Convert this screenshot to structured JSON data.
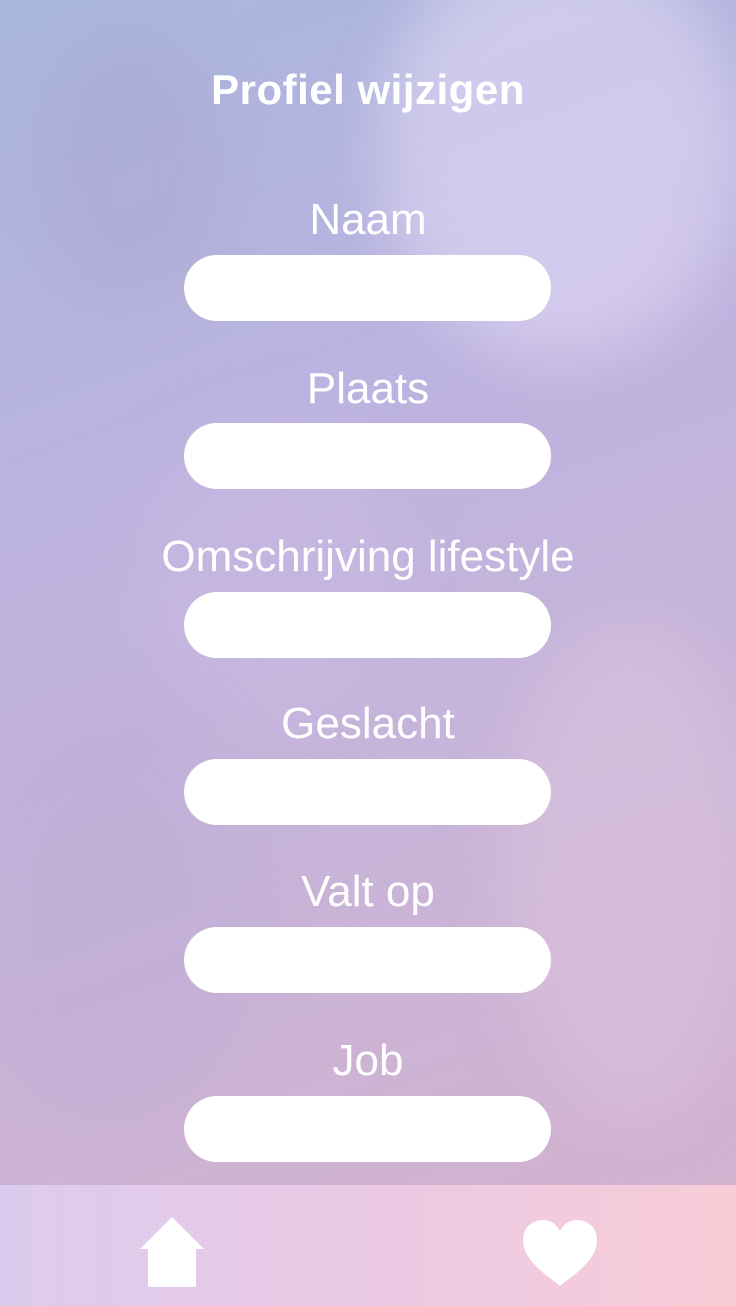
{
  "header": {
    "title": "Profiel wijzigen"
  },
  "form": {
    "fields": [
      {
        "label": "Naam",
        "value": "",
        "placeholder": ""
      },
      {
        "label": "Plaats",
        "value": "",
        "placeholder": ""
      },
      {
        "label": "Omschrijving lifestyle",
        "value": "",
        "placeholder": ""
      },
      {
        "label": "Geslacht",
        "value": "",
        "placeholder": ""
      },
      {
        "label": "Valt op",
        "value": "",
        "placeholder": ""
      },
      {
        "label": "Job",
        "value": "",
        "placeholder": ""
      }
    ]
  },
  "nav": {
    "items": [
      {
        "icon": "home-icon"
      },
      {
        "icon": "heart-icon"
      }
    ]
  },
  "colors": {
    "background_gradient_start": "#a8b6dd",
    "background_gradient_end": "#d2b2cf",
    "bottom_bar_start": "#dccbee",
    "bottom_bar_end": "#f8ccd6",
    "text": "#ffffff",
    "input_background": "#ffffff"
  }
}
